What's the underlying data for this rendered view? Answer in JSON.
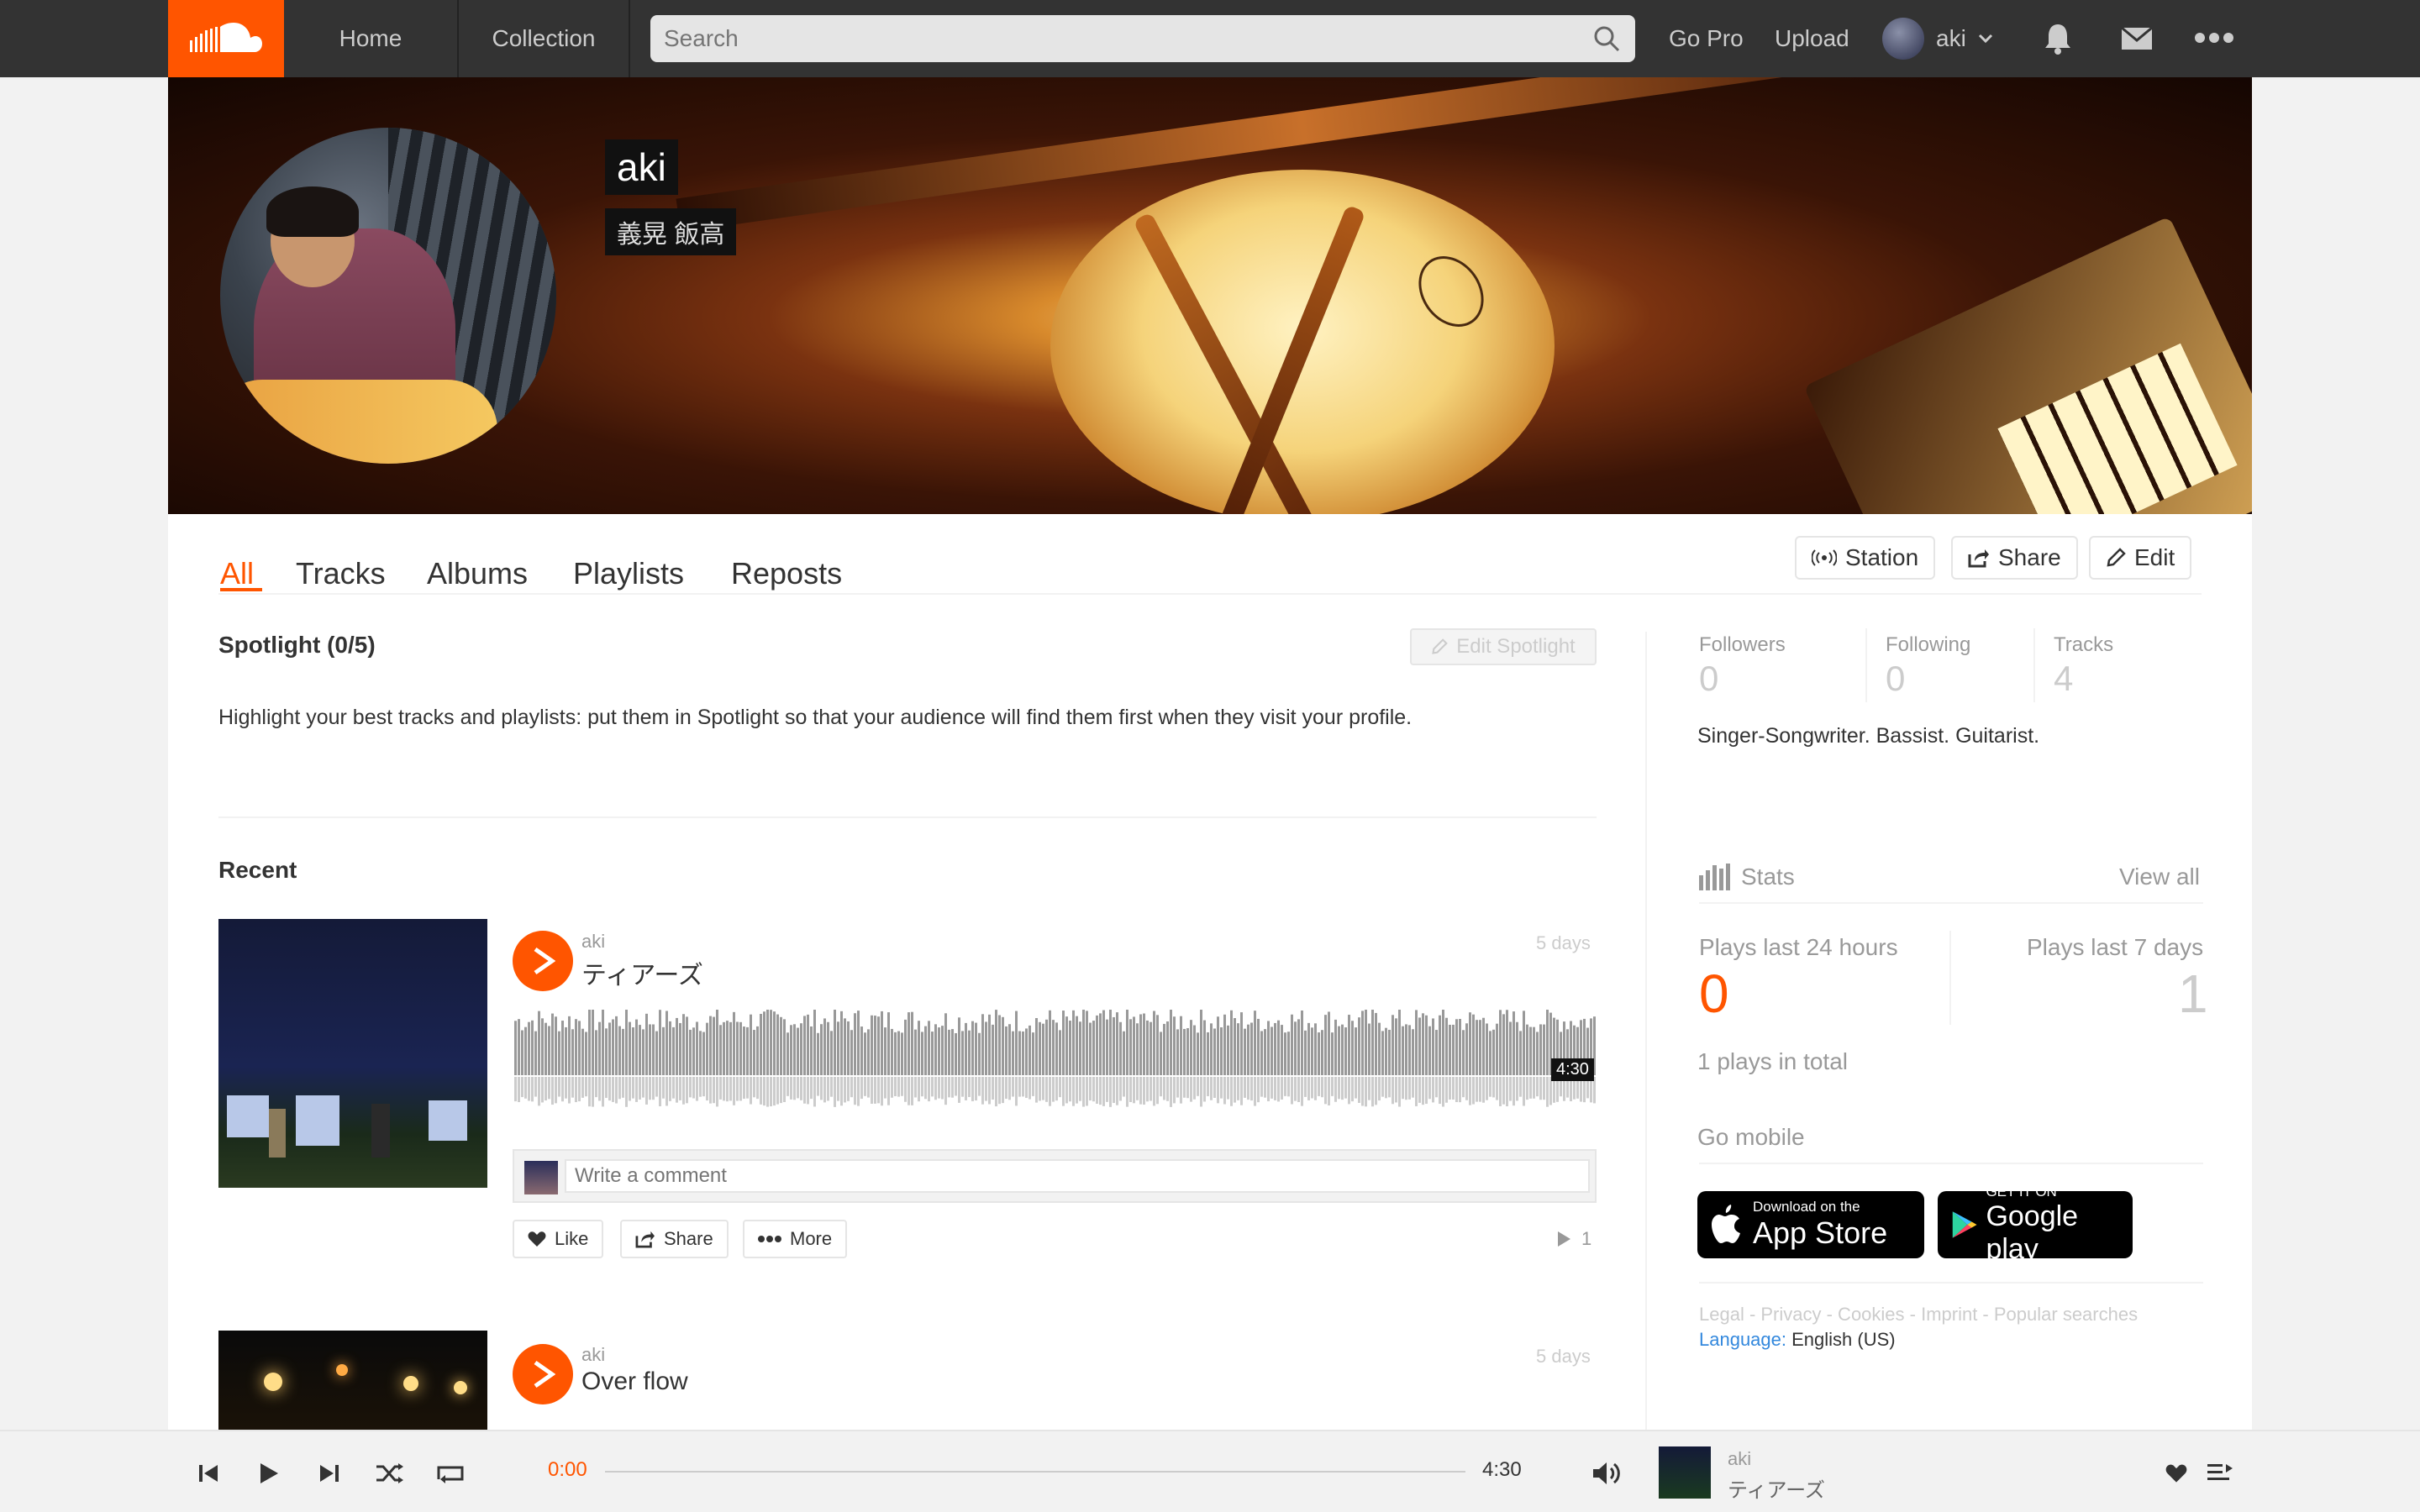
{
  "colors": {
    "accent": "#ff5500",
    "header_bg": "#333333",
    "page_bg": "#f2f2f2"
  },
  "header": {
    "logo_icon": "soundcloud-logo-icon",
    "nav": [
      "Home",
      "Collection"
    ],
    "search_placeholder": "Search",
    "go_pro": "Go Pro",
    "upload": "Upload",
    "username": "aki",
    "icons": [
      "bell-icon",
      "mail-icon",
      "more-icon"
    ]
  },
  "profile": {
    "name": "aki",
    "real_name": "義晃 飯高"
  },
  "tabs": {
    "all": "All",
    "tracks": "Tracks",
    "albums": "Albums",
    "playlists": "Playlists",
    "reposts": "Reposts",
    "active": "All"
  },
  "actions": {
    "station": "Station",
    "share": "Share",
    "edit": "Edit"
  },
  "spotlight": {
    "title": "Spotlight (0/5)",
    "edit_label": "Edit Spotlight",
    "description": "Highlight your best tracks and playlists: put them in Spotlight so that your audience will find them first when they visit your profile."
  },
  "recent": {
    "title": "Recent",
    "tracks": [
      {
        "artist": "aki",
        "title": "ティアーズ",
        "posted": "5 days",
        "duration": "4:30",
        "comment_placeholder": "Write a comment",
        "like": "Like",
        "share": "Share",
        "more": "More",
        "plays": "1"
      },
      {
        "artist": "aki",
        "title": "Over flow",
        "posted": "5 days"
      }
    ]
  },
  "sidebar": {
    "followers_label": "Followers",
    "followers": "0",
    "following_label": "Following",
    "following": "0",
    "tracks_label": "Tracks",
    "tracks": "4",
    "bio": "Singer-Songwriter. Bassist. Guitarist.",
    "stats_title": "Stats",
    "view_all": "View all",
    "plays_24h_label": "Plays last 24 hours",
    "plays_24h": "0",
    "plays_7d_label": "Plays last 7 days",
    "plays_7d": "1",
    "plays_total": "1 plays in total",
    "go_mobile": "Go mobile",
    "app_store_small": "Download on the",
    "app_store_big": "App Store",
    "google_small": "GET IT ON",
    "google_big": "Google play",
    "footer_links": "Legal - Privacy - Cookies - Imprint - Popular searches",
    "language_label": "Language:",
    "language": "English (US)"
  },
  "player": {
    "current_time": "0:00",
    "duration": "4:30",
    "artist": "aki",
    "title": "ティアーズ",
    "progress": 0
  }
}
